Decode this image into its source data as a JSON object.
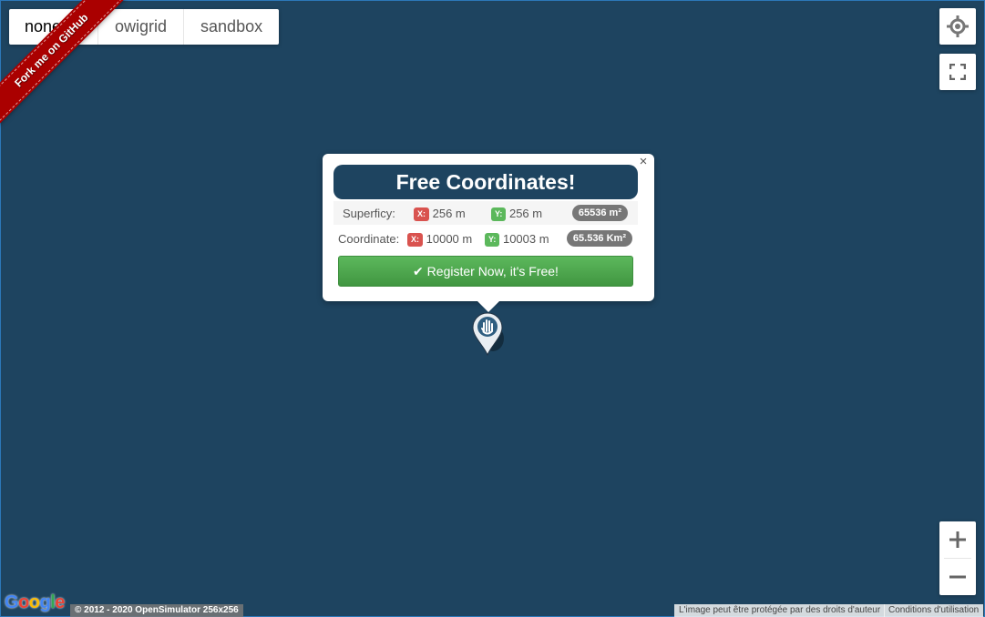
{
  "grid_tabs": [
    {
      "label": "none"
    },
    {
      "label": "owigrid"
    },
    {
      "label": "sandbox"
    }
  ],
  "ribbon": {
    "label": "Fork me on GitHub"
  },
  "controls": {
    "locate_icon": "crosshair-icon",
    "fullscreen_icon": "fullscreen-icon",
    "zoom_in_label": "+",
    "zoom_out_label": "−"
  },
  "popup": {
    "close_label": "×",
    "title": "Free Coordinates!",
    "superficy": {
      "label": "Superficy:",
      "x_tag": "X:",
      "x_value": "256 m",
      "y_tag": "Y:",
      "y_value": "256 m",
      "area": "65536 m²"
    },
    "coordinate": {
      "label": "Coordinate:",
      "x_tag": "X:",
      "x_value": "10000 m",
      "y_tag": "Y:",
      "y_value": "10003 m",
      "area": "65.536 Km²"
    },
    "register_label": "✔ Register Now, it's Free!"
  },
  "footer": {
    "logo": "Google",
    "copyright": "© 2012 - 2020 OpenSimulator 256x256",
    "image_notice": "L'image peut être protégée par des droits d'auteur",
    "terms": "Conditions d'utilisation"
  },
  "colors": {
    "map_background": "#1e4460",
    "ribbon": "#aa0000",
    "register_button": "#5cb85c",
    "x_tag": "#d9534f",
    "y_tag": "#5cb85c"
  }
}
